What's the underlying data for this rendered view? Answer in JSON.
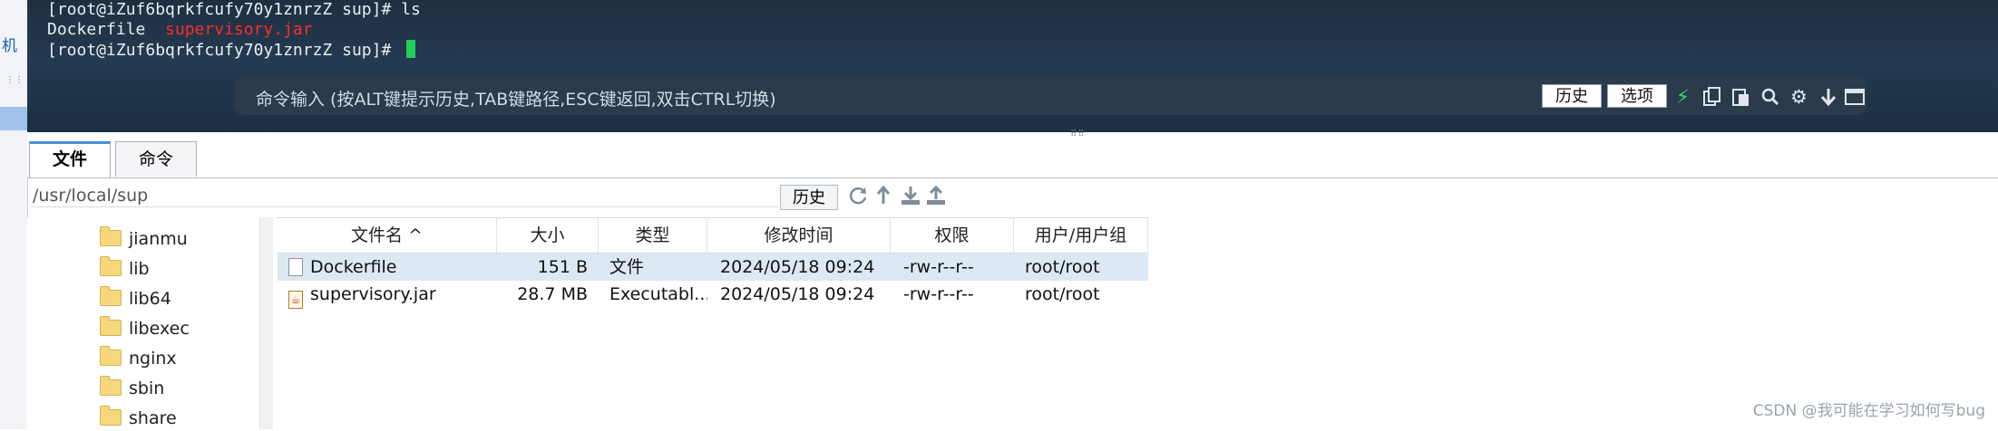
{
  "left_window": {
    "char": "机",
    "mark": "⋮⋮"
  },
  "terminal": {
    "line1": "[root@iZuf6bqrkfcufy70y1znrzZ sup]# ls",
    "line2_normal": "Dockerfile  ",
    "line2_red": "supervisory.jar",
    "line3": "[root@iZuf6bqrkfcufy70y1znrzZ sup]# ",
    "command_bar": {
      "placeholder": "命令输入 (按ALT键提示历史,TAB键路径,ESC键返回,双击CTRL切换)",
      "history_label": "历史",
      "options_label": "选项",
      "icons": [
        "bolt-icon",
        "copy-icon",
        "paste-icon",
        "search-icon",
        "gear-icon",
        "down-arrow-icon",
        "window-icon"
      ]
    }
  },
  "splitter_grip": "⠿⠿",
  "tabs": [
    {
      "label": "文件",
      "active": true
    },
    {
      "label": "命令",
      "active": false
    }
  ],
  "path_bar": {
    "path": "/usr/local/sup",
    "history_label": "历史",
    "icons": [
      "refresh-icon",
      "up-icon",
      "download-icon",
      "upload-icon"
    ]
  },
  "tree": {
    "items": [
      "jianmu",
      "lib",
      "lib64",
      "libexec",
      "nginx",
      "sbin",
      "share"
    ]
  },
  "file_table": {
    "columns": [
      "文件名 ^",
      "大小",
      "类型",
      "修改时间",
      "权限",
      "用户/用户组"
    ],
    "sort_column": "文件名",
    "rows": [
      {
        "name": "Dockerfile",
        "size": "151 B",
        "type": "文件",
        "modified": "2024/05/18 09:24",
        "perms": "-rw-r--r--",
        "owner": "root/root",
        "icon": "file-icon",
        "selected": true
      },
      {
        "name": "supervisory.jar",
        "size": "28.7 MB",
        "type": "Executabl...",
        "modified": "2024/05/18 09:24",
        "perms": "-rw-r--r--",
        "owner": "root/root",
        "icon": "jar-icon",
        "selected": false
      }
    ]
  },
  "watermark": "CSDN @我可能在学习如何写bug",
  "colors": {
    "terminal_bg": "#243a50",
    "cursor": "#1fd15a",
    "highlight_red": "#ff2b2b",
    "selection": "#dce9f4"
  }
}
